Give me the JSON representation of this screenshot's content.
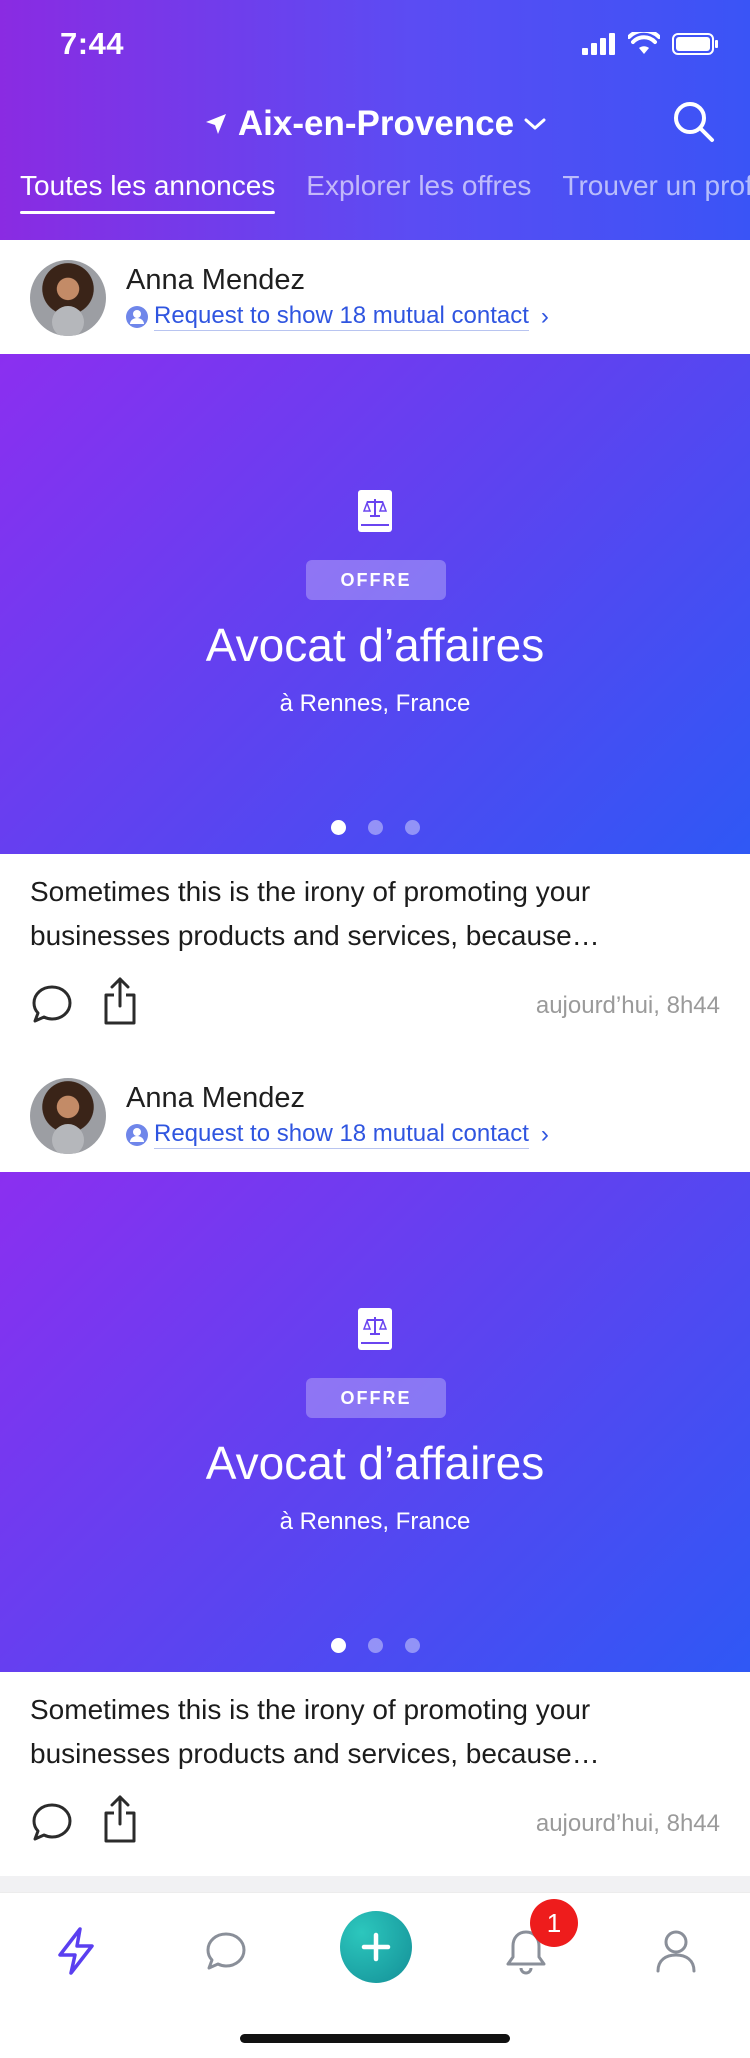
{
  "status_bar": {
    "time": "7:44"
  },
  "header": {
    "location": "Aix-en-Provence",
    "tabs": [
      {
        "label": "Toutes les annonces",
        "active": true
      },
      {
        "label": "Explorer les offres",
        "active": false
      },
      {
        "label": "Trouver un profil",
        "active": false
      }
    ]
  },
  "colors": {
    "header_gradient_start": "#8a2be2",
    "header_gradient_end": "#3a54f6",
    "link_blue": "#2f55e0",
    "add_button": "#1fa7a8",
    "notification_badge": "#ee1c1c"
  },
  "feed": [
    {
      "author": "Anna Mendez",
      "mutual_text": "Request to show 18 mutual contact",
      "badge": "OFFRE",
      "title": "Avocat d’affaires",
      "subtitle": "à Rennes, France",
      "carousel_count": 3,
      "carousel_active": 1,
      "text": "Sometimes this is the irony of promoting your businesses products and services, because…",
      "timestamp": "aujourd’hui, 8h44"
    },
    {
      "author": "Anna Mendez",
      "mutual_text": "Request to show 18 mutual contact",
      "badge": "OFFRE",
      "title": "Avocat d’affaires",
      "subtitle": "à Rennes, France",
      "carousel_count": 3,
      "carousel_active": 1,
      "text": "Sometimes this is the irony of promoting your businesses products and services, because…",
      "timestamp": "aujourd’hui, 8h44"
    }
  ],
  "bottom_nav": {
    "items": [
      {
        "icon": "bolt-icon"
      },
      {
        "icon": "chat-icon"
      },
      {
        "icon": "plus-icon"
      },
      {
        "icon": "bell-icon"
      },
      {
        "icon": "user-icon"
      }
    ],
    "notification_count": "1"
  }
}
